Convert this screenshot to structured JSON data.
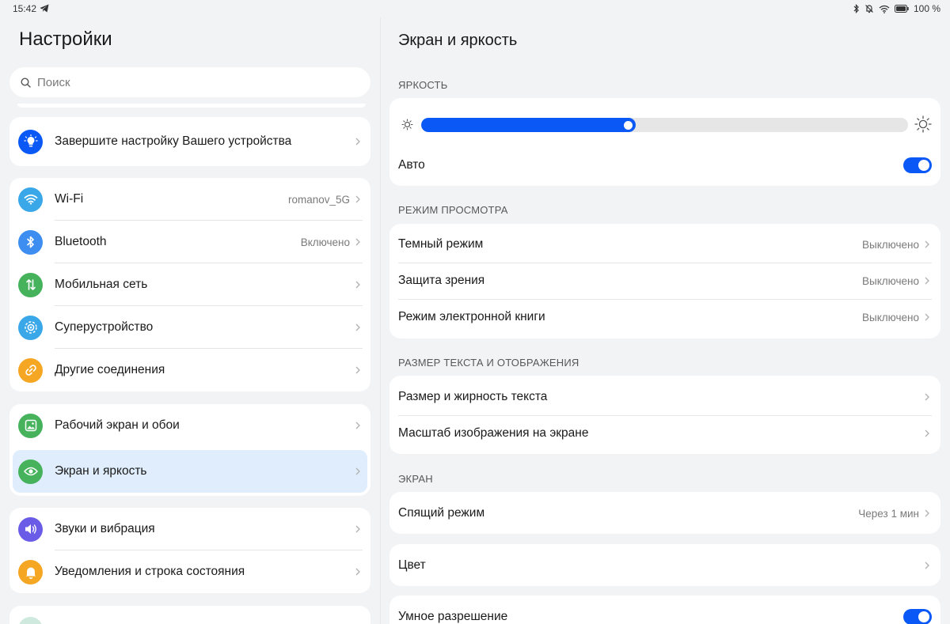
{
  "status_bar": {
    "time": "15:42",
    "battery": "100 %"
  },
  "left": {
    "title": "Настройки",
    "search_placeholder": "Поиск",
    "setup_card": {
      "label": "Завершите настройку Вашего устройства"
    },
    "connectivity": [
      {
        "label": "Wi-Fi",
        "value": "romanov_5G"
      },
      {
        "label": "Bluetooth",
        "value": "Включено"
      },
      {
        "label": "Мобильная сеть"
      },
      {
        "label": "Суперустройство"
      },
      {
        "label": "Другие соединения"
      }
    ],
    "display_group": [
      {
        "label": "Рабочий экран и обои"
      },
      {
        "label": "Экран и яркость"
      }
    ],
    "sound_group": [
      {
        "label": "Звуки и вибрация"
      },
      {
        "label": "Уведомления и строка состояния"
      }
    ]
  },
  "right": {
    "title": "Экран и яркость",
    "brightness": {
      "header": "ЯРКОСТЬ",
      "level": 0.44,
      "auto_label": "Авто",
      "auto_on": true
    },
    "view_mode": {
      "header": "РЕЖИМ ПРОСМОТРА",
      "rows": [
        {
          "label": "Темный режим",
          "value": "Выключено"
        },
        {
          "label": "Защита зрения",
          "value": "Выключено"
        },
        {
          "label": "Режим электронной книги",
          "value": "Выключено"
        }
      ]
    },
    "text_size": {
      "header": "РАЗМЕР ТЕКСТА И ОТОБРАЖЕНИЯ",
      "rows": [
        {
          "label": "Размер и жирность текста"
        },
        {
          "label": "Масштаб изображения на экране"
        }
      ]
    },
    "screen": {
      "header": "ЭКРАН",
      "sleep": {
        "label": "Спящий режим",
        "value": "Через 1 мин"
      },
      "color": {
        "label": "Цвет"
      },
      "smart_resolution": {
        "label": "Умное разрешение",
        "on": true
      }
    }
  },
  "colors": {
    "accent": "#0a59f7",
    "active_row": "#dfedfc",
    "icon_setup": "#0a59f7",
    "icon_wifi": "#3aa8e8",
    "icon_bluetooth": "#3d8ef0",
    "icon_mobile": "#46b25c",
    "icon_super": "#3aa8e8",
    "icon_other": "#f5a623",
    "icon_wallpaper": "#46b25c",
    "icon_display": "#46b25c",
    "icon_sound": "#6b5ce7",
    "icon_notifications": "#f5a623"
  }
}
